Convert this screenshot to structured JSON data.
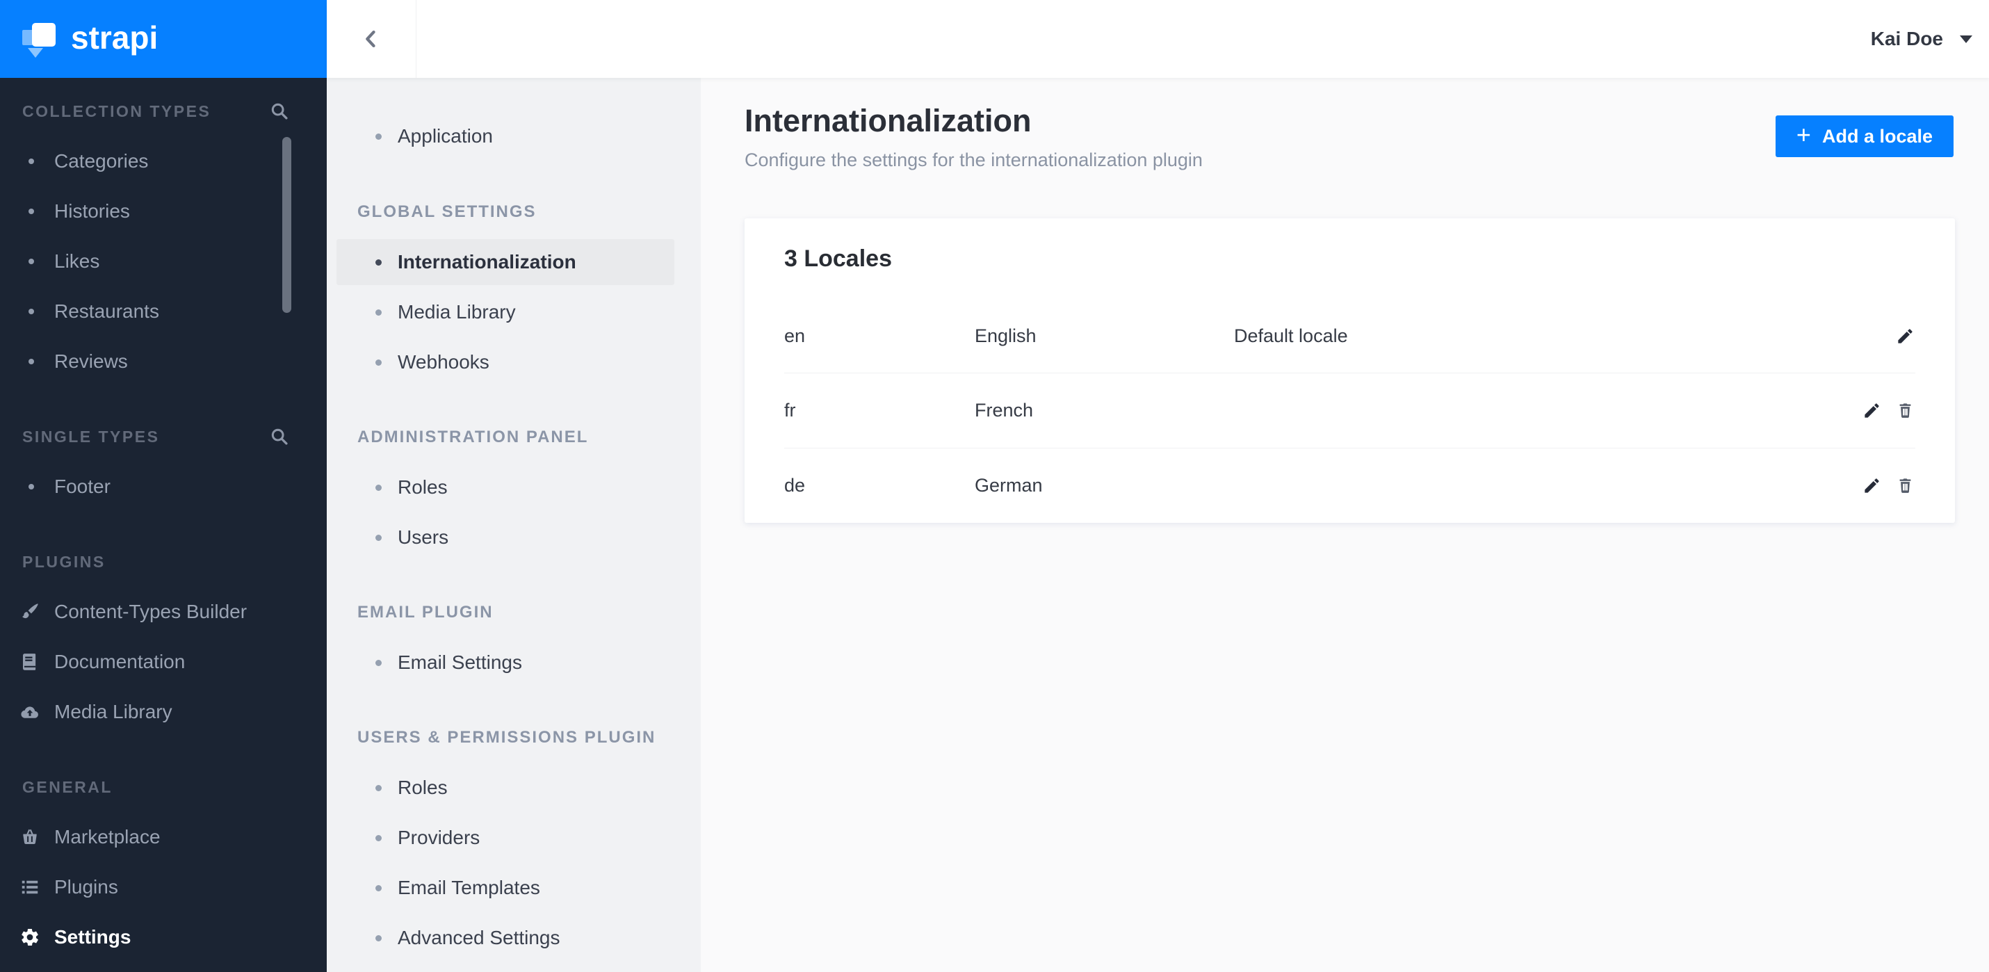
{
  "app": {
    "brand": "strapi",
    "user_name": "Kai Doe"
  },
  "colors": {
    "accent_blue": "#0680ff",
    "sidebar_bg": "#1b2433",
    "sidebar_text": "#9aa3b3",
    "settings_nav_bg": "#f1f2f4",
    "settings_nav_active_bg": "#e9eaec",
    "main_bg": "#fafafb",
    "card_bg": "#ffffff",
    "title_text": "#2b2f38",
    "subtitle_text": "#8a93a3"
  },
  "icons": {
    "search-icon": "magnifier",
    "brush-icon": "paintbrush",
    "book-icon": "book",
    "cloud-upload-icon": "cloud with up arrow",
    "basket-icon": "shopping basket",
    "list-icon": "bulleted list",
    "gear-icon": "gear",
    "pencil-icon": "pencil",
    "trash-icon": "trash can",
    "chevron-left-icon": "back chevron",
    "caret-down-icon": "down caret",
    "plus-icon": "plus sign",
    "strapi-logo-icon": "strapi mark"
  },
  "sidebar": {
    "sections": [
      {
        "label": "COLLECTION TYPES",
        "has_search": true,
        "items": [
          {
            "label": "Categories"
          },
          {
            "label": "Histories"
          },
          {
            "label": "Likes"
          },
          {
            "label": "Restaurants"
          },
          {
            "label": "Reviews"
          }
        ]
      },
      {
        "label": "SINGLE TYPES",
        "has_search": true,
        "items": [
          {
            "label": "Footer"
          }
        ]
      },
      {
        "label": "PLUGINS",
        "has_search": false,
        "items": [
          {
            "label": "Content-Types Builder",
            "icon": "brush-icon"
          },
          {
            "label": "Documentation",
            "icon": "book-icon"
          },
          {
            "label": "Media Library",
            "icon": "cloud-upload-icon"
          }
        ]
      },
      {
        "label": "GENERAL",
        "has_search": false,
        "items": [
          {
            "label": "Marketplace",
            "icon": "basket-icon"
          },
          {
            "label": "Plugins",
            "icon": "list-icon"
          },
          {
            "label": "Settings",
            "icon": "gear-icon",
            "active": true
          }
        ]
      }
    ]
  },
  "settings_nav": {
    "top_items": [
      {
        "label": "Application"
      }
    ],
    "sections": [
      {
        "label": "GLOBAL SETTINGS",
        "items": [
          {
            "label": "Internationalization",
            "active": true
          },
          {
            "label": "Media Library"
          },
          {
            "label": "Webhooks"
          }
        ]
      },
      {
        "label": "ADMINISTRATION PANEL",
        "items": [
          {
            "label": "Roles"
          },
          {
            "label": "Users"
          }
        ]
      },
      {
        "label": "EMAIL PLUGIN",
        "items": [
          {
            "label": "Email Settings"
          }
        ]
      },
      {
        "label": "USERS & PERMISSIONS PLUGIN",
        "items": [
          {
            "label": "Roles"
          },
          {
            "label": "Providers"
          },
          {
            "label": "Email Templates"
          },
          {
            "label": "Advanced Settings"
          }
        ]
      }
    ]
  },
  "main": {
    "title": "Internationalization",
    "subtitle": "Configure the settings for the internationalization plugin",
    "add_button_label": "Add a locale",
    "card": {
      "title": "3 Locales",
      "rows": [
        {
          "code": "en",
          "name": "English",
          "note": "Default locale",
          "actions": [
            "edit"
          ]
        },
        {
          "code": "fr",
          "name": "French",
          "note": "",
          "actions": [
            "edit",
            "delete"
          ]
        },
        {
          "code": "de",
          "name": "German",
          "note": "",
          "actions": [
            "edit",
            "delete"
          ]
        }
      ]
    }
  }
}
